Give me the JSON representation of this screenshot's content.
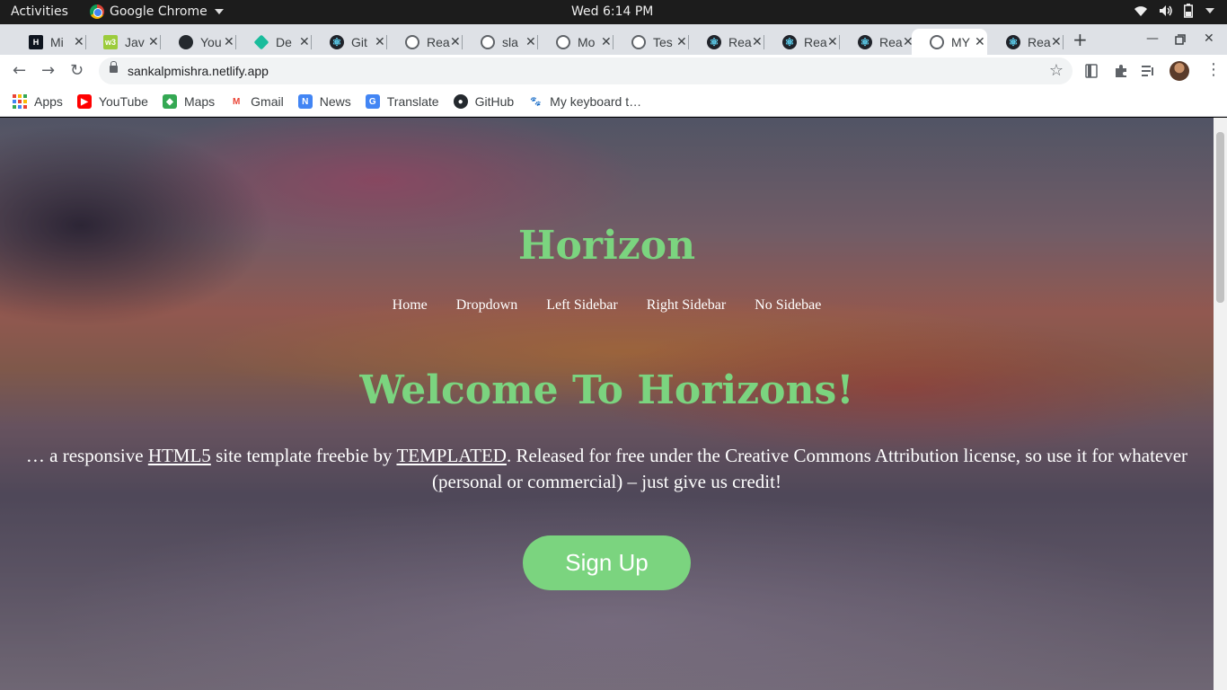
{
  "system_bar": {
    "activities": "Activities",
    "app_name": "Google Chrome",
    "clock": "Wed  6:14 PM",
    "tray_icons": [
      "wifi-icon",
      "volume-icon",
      "battery-icon",
      "power-menu-caret"
    ]
  },
  "tabs": [
    {
      "title": "Mi",
      "favicon": "hackerrank-icon",
      "color": "#0e141e",
      "active": false
    },
    {
      "title": "Jav",
      "favicon": "w3schools-icon",
      "color": "#9ccc3c",
      "active": false
    },
    {
      "title": "You",
      "favicon": "github-icon",
      "color": "#24292e",
      "active": false
    },
    {
      "title": "De",
      "favicon": "diamond-icon",
      "color": "#1abc9c",
      "active": false
    },
    {
      "title": "Git",
      "favicon": "react-icon",
      "color": "#20232a",
      "active": false
    },
    {
      "title": "Rea",
      "favicon": "globe-icon",
      "color": "#5f6368",
      "active": false
    },
    {
      "title": "sla",
      "favicon": "globe-icon",
      "color": "#5f6368",
      "active": false
    },
    {
      "title": "Mo",
      "favicon": "globe-icon",
      "color": "#5f6368",
      "active": false
    },
    {
      "title": "Tes",
      "favicon": "globe-icon",
      "color": "#5f6368",
      "active": false
    },
    {
      "title": "Rea",
      "favicon": "react-icon",
      "color": "#20232a",
      "active": false
    },
    {
      "title": "Rea",
      "favicon": "react-icon",
      "color": "#20232a",
      "active": false
    },
    {
      "title": "Rea",
      "favicon": "react-icon",
      "color": "#20232a",
      "active": false
    },
    {
      "title": "MY",
      "favicon": "globe-icon",
      "color": "#5f6368",
      "active": true
    },
    {
      "title": "Rea",
      "favicon": "react-icon",
      "color": "#20232a",
      "active": false
    }
  ],
  "address_bar": {
    "url": "sankalpmishra.netlify.app"
  },
  "bookmarks": [
    {
      "label": "Apps",
      "icon": "apps-grid-icon"
    },
    {
      "label": "YouTube",
      "icon": "youtube-icon"
    },
    {
      "label": "Maps",
      "icon": "maps-icon"
    },
    {
      "label": "Gmail",
      "icon": "gmail-icon"
    },
    {
      "label": "News",
      "icon": "news-icon"
    },
    {
      "label": "Translate",
      "icon": "translate-icon"
    },
    {
      "label": "GitHub",
      "icon": "github-icon"
    },
    {
      "label": "My keyboard t…",
      "icon": "paw-icon"
    }
  ],
  "site": {
    "title": "Horizon",
    "nav": [
      "Home",
      "Dropdown",
      "Left Sidebar",
      "Right Sidebar",
      "No Sidebae"
    ],
    "hero_title": "Welcome To Horizons!",
    "hero_text_before": "… a responsive ",
    "hero_link1": "HTML5",
    "hero_text_mid": " site template freebie by ",
    "hero_link2": "TEMPLATED",
    "hero_text_after": ". Released for free under the Creative Commons Attribution license, so use it for whatever (personal or commercial) – just give us credit!",
    "cta": "Sign Up",
    "accent": "#7bd47f"
  }
}
